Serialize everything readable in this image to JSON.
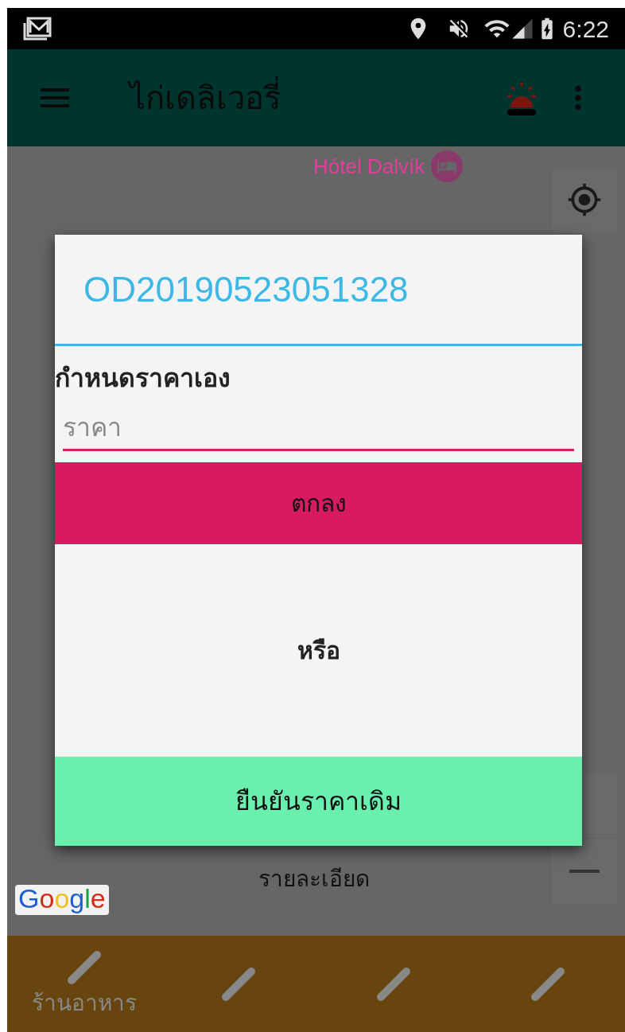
{
  "status_bar": {
    "time": "6:22"
  },
  "app_bar": {
    "title": "ไก่เดลิเวอรี่"
  },
  "map": {
    "place_label": "Hótel Dalvík",
    "caption": "รายละเอียด",
    "logo": "Google"
  },
  "dialog": {
    "title": "OD20190523051328",
    "field_label": "กำหนดราคาเอง",
    "price_field": {
      "placeholder": "ราคา"
    },
    "ok_button": "ตกลง",
    "separator": "หรือ",
    "confirm_button": "ยืนยันราคาเดิม"
  },
  "bottom_nav": [
    {
      "kind": "labeled",
      "label": "ร้านอาหาร"
    },
    {
      "kind": "icon"
    },
    {
      "kind": "icon"
    },
    {
      "kind": "icon"
    }
  ]
}
